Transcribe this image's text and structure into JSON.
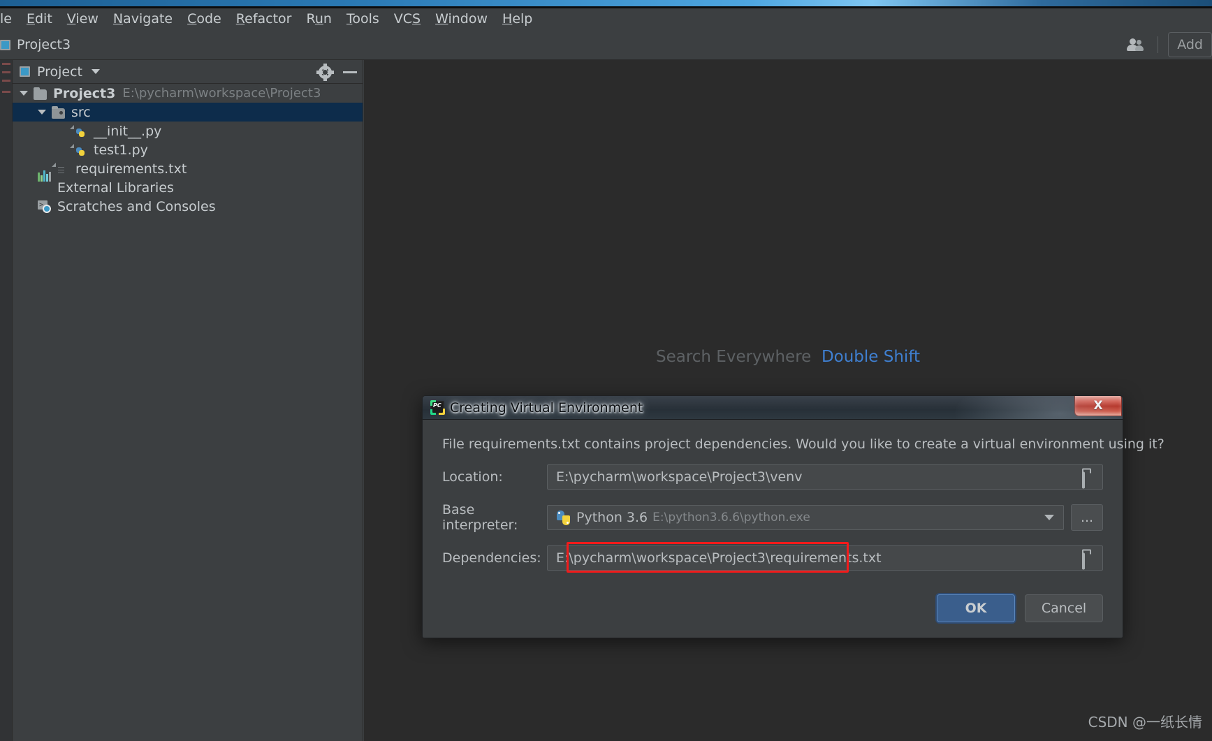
{
  "window": {
    "menu": [
      {
        "label": "le",
        "mnemonic": ""
      },
      {
        "label": "Edit",
        "mnemonic": "E"
      },
      {
        "label": "View",
        "mnemonic": "V"
      },
      {
        "label": "Navigate",
        "mnemonic": "N"
      },
      {
        "label": "Code",
        "mnemonic": "C"
      },
      {
        "label": "Refactor",
        "mnemonic": "R"
      },
      {
        "label": "Run",
        "mnemonic": "u"
      },
      {
        "label": "Tools",
        "mnemonic": "T"
      },
      {
        "label": "VCS",
        "mnemonic": "S"
      },
      {
        "label": "Window",
        "mnemonic": "W"
      },
      {
        "label": "Help",
        "mnemonic": "H"
      }
    ]
  },
  "toolbar": {
    "project_name": "Project3",
    "project_icon": "project-module-icon",
    "people_icon": "people-icon",
    "add_button_label": "Add"
  },
  "project_panel": {
    "title": "Project",
    "title_icon": "project-window-icon",
    "dropdown_icon": "chevron-down-icon",
    "settings_icon": "gear-icon",
    "hide_icon": "minimize-icon",
    "tree": [
      {
        "label": "Project3",
        "path": "E:\\pycharm\\workspace\\Project3",
        "icon": "folder-icon",
        "indent": 0,
        "expanded": true,
        "bold": true,
        "selected": false
      },
      {
        "label": "src",
        "path": "",
        "icon": "source-folder-icon",
        "indent": 1,
        "expanded": true,
        "bold": false,
        "selected": true
      },
      {
        "label": "__init__.py",
        "path": "",
        "icon": "python-file-icon",
        "indent": 3,
        "expanded": null,
        "bold": false,
        "selected": false
      },
      {
        "label": "test1.py",
        "path": "",
        "icon": "python-file-icon",
        "indent": 3,
        "expanded": null,
        "bold": false,
        "selected": false
      },
      {
        "label": "requirements.txt",
        "path": "",
        "icon": "text-file-icon",
        "indent": 2,
        "expanded": null,
        "bold": false,
        "selected": false
      },
      {
        "label": "External Libraries",
        "path": "",
        "icon": "libraries-icon",
        "indent": 1,
        "expanded": null,
        "bold": false,
        "selected": false
      },
      {
        "label": "Scratches and Consoles",
        "path": "",
        "icon": "scratches-icon",
        "indent": 1,
        "expanded": null,
        "bold": false,
        "selected": false
      }
    ]
  },
  "editor": {
    "search_hint_text": "Search Everywhere",
    "search_hint_shortcut": "Double Shift"
  },
  "dialog": {
    "title": "Creating Virtual Environment",
    "title_icon": "pycharm-icon",
    "close_label": "X",
    "message": "File requirements.txt contains project dependencies. Would you like to create a virtual environment using it?",
    "fields": [
      {
        "label": "Location:",
        "value": "E:\\pycharm\\workspace\\Project3\\venv",
        "hint": "",
        "trailing_icon": "folder-browse-icon",
        "type": "path"
      },
      {
        "label": "Base interpreter:",
        "value": "Python 3.6",
        "hint": "E:\\python3.6.6\\python.exe",
        "trailing_icon": "chevron-down-icon",
        "type": "combo",
        "extra_button": "..."
      },
      {
        "label": "Dependencies:",
        "value": "E:\\pycharm\\workspace\\Project3\\requirements.txt",
        "hint": "",
        "trailing_icon": "folder-browse-icon",
        "type": "path",
        "highlighted": true
      }
    ],
    "ok_label": "OK",
    "cancel_label": "Cancel",
    "highlight_color": "#f21b1b"
  },
  "watermark": "CSDN @一纸长情"
}
